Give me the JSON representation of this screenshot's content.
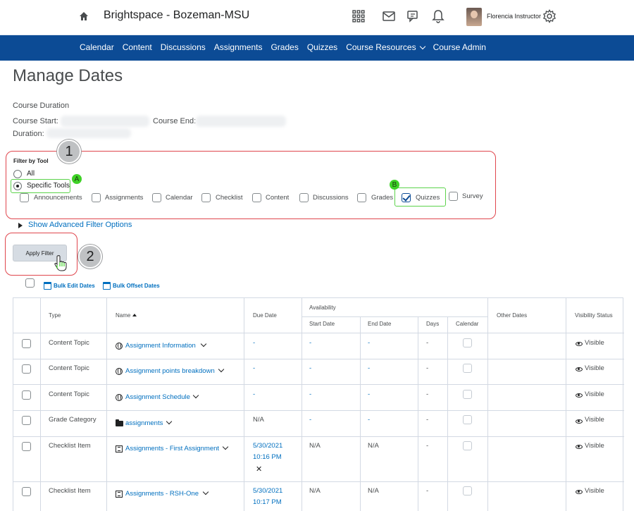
{
  "header": {
    "org_name": "Brightspace - Bozeman-MSU",
    "user_name": "Florencia Instructor",
    "icons": [
      "home-icon",
      "apps-grid-icon",
      "mail-icon",
      "chat-icon",
      "bell-icon",
      "gear-icon"
    ]
  },
  "nav": {
    "items": [
      "Calendar",
      "Content",
      "Discussions",
      "Assignments",
      "Grades",
      "Quizzes",
      "Course Resources",
      "Course Admin"
    ]
  },
  "page": {
    "title": "Manage Dates",
    "course_duration": "Course Duration",
    "course_start": "Course Start:",
    "course_end": "Course End:",
    "duration": "Duration:"
  },
  "filter": {
    "label": "Filter by Tool",
    "option_all": "All",
    "option_specific": "Specific Tools",
    "selected": "Specific Tools",
    "tools": [
      {
        "label": "Announcements",
        "checked": false
      },
      {
        "label": "Assignments",
        "checked": false
      },
      {
        "label": "Calendar",
        "checked": false
      },
      {
        "label": "Checklist",
        "checked": false
      },
      {
        "label": "Content",
        "checked": false
      },
      {
        "label": "Discussions",
        "checked": false
      },
      {
        "label": "Grades",
        "checked": false
      },
      {
        "label": "Quizzes",
        "checked": true
      },
      {
        "label": "Survey",
        "checked": false
      }
    ],
    "advanced": "Show Advanced Filter Options",
    "apply": "Apply Filter"
  },
  "callouts": {
    "step1": "1",
    "step2": "2",
    "a": "A",
    "b": "B"
  },
  "bulk": {
    "edit": "Bulk Edit Dates",
    "offset": "Bulk Offset Dates"
  },
  "table": {
    "headers": {
      "type": "Type",
      "name": "Name",
      "name_sort_icon": "sort-ascending-icon",
      "due": "Due Date",
      "availability": "Availability",
      "start": "Start Date",
      "end": "End Date",
      "days": "Days",
      "calendar": "Calendar",
      "other": "Other Dates",
      "visibility": "Visibility Status"
    },
    "rows": [
      {
        "type": "Content Topic",
        "icon": "globe-icon",
        "name": "Assignment Information",
        "due": "-",
        "start": "-",
        "end": "-",
        "days": "-",
        "visibility": "Visible"
      },
      {
        "type": "Content Topic",
        "icon": "globe-icon",
        "name": "Assignment points breakdown",
        "due": "-",
        "start": "-",
        "end": "-",
        "days": "-",
        "visibility": "Visible"
      },
      {
        "type": "Content Topic",
        "icon": "globe-icon",
        "name": "Assignment Schedule",
        "due": "-",
        "start": "-",
        "end": "-",
        "days": "-",
        "visibility": "Visible"
      },
      {
        "type": "Grade Category",
        "icon": "folder-icon",
        "name": "assignments",
        "due": "N/A",
        "start": "-",
        "end": "-",
        "days": "-",
        "visibility": "Visible"
      },
      {
        "type": "Checklist Item",
        "icon": "list-icon",
        "name": "Assignments - First Assignment",
        "due": "5/30/2021",
        "due_time": "10:16 PM",
        "start": "N/A",
        "end": "N/A",
        "days": "-",
        "visibility": "Visible",
        "clear": "✕"
      },
      {
        "type": "Checklist Item",
        "icon": "list-icon",
        "name": "Assignments - RSH-One",
        "due": "5/30/2021",
        "due_time": "10:17 PM",
        "start": "N/A",
        "end": "N/A",
        "days": "-",
        "visibility": "Visible"
      }
    ]
  }
}
